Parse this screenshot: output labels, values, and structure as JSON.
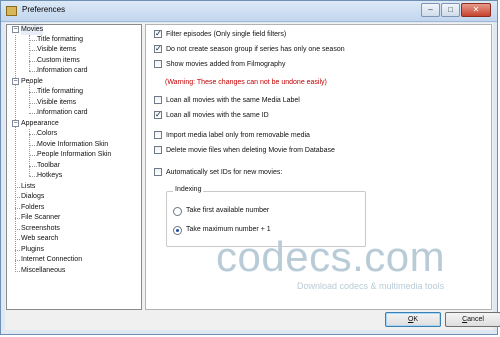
{
  "window": {
    "title": "Preferences",
    "minimize": "–",
    "maximize": "□",
    "close": "✕"
  },
  "tree": {
    "movies": "Movies",
    "movies_children": [
      "Title formatting",
      "Visible items",
      "Custom items",
      "Information card"
    ],
    "people": "People",
    "people_children": [
      "Title formatting",
      "Visible items",
      "Information card"
    ],
    "appearance": "Appearance",
    "appearance_children": [
      "Colors",
      "Movie Information Skin",
      "People Information Skin",
      "Toolbar",
      "Hotkeys"
    ],
    "others": [
      "Lists",
      "Dialogs",
      "Folders",
      "File Scanner",
      "Screenshots",
      "Web search",
      "Plugins",
      "Internet Connection",
      "Miscellaneous"
    ],
    "expander": "−"
  },
  "options": {
    "filter_episodes": {
      "label": "Filter episodes (Only single field filters)",
      "checked": true
    },
    "no_season_group": {
      "label": "Do not create season group if series has only one season",
      "checked": true
    },
    "show_from_filmography": {
      "label": "Show movies added from Filmography",
      "checked": false
    },
    "warning": "(Warning: These changes can not be undone easily)",
    "loan_same_label": {
      "label": "Loan all movies with the same Media Label",
      "checked": false
    },
    "loan_same_id": {
      "label": "Loan all movies with the same ID",
      "checked": true
    },
    "import_removable": {
      "label": "Import media label only from removable media",
      "checked": false
    },
    "delete_files": {
      "label": "Delete movie files when deleting Movie from Database",
      "checked": false
    },
    "auto_ids": {
      "label": "Automatically set IDs for new movies:",
      "checked": false
    },
    "checkmark": "✓"
  },
  "indexing": {
    "title": "Indexing",
    "first_available": "Take first available number",
    "max_plus_one": "Take maximum number + 1",
    "selected": "max_plus_one"
  },
  "watermark": {
    "text": "codecs.com",
    "subtext": "Download codecs & multimedia tools"
  },
  "buttons": {
    "ok_u": "O",
    "ok_rest": "K",
    "cancel_u": "C",
    "cancel_rest": "ancel"
  }
}
